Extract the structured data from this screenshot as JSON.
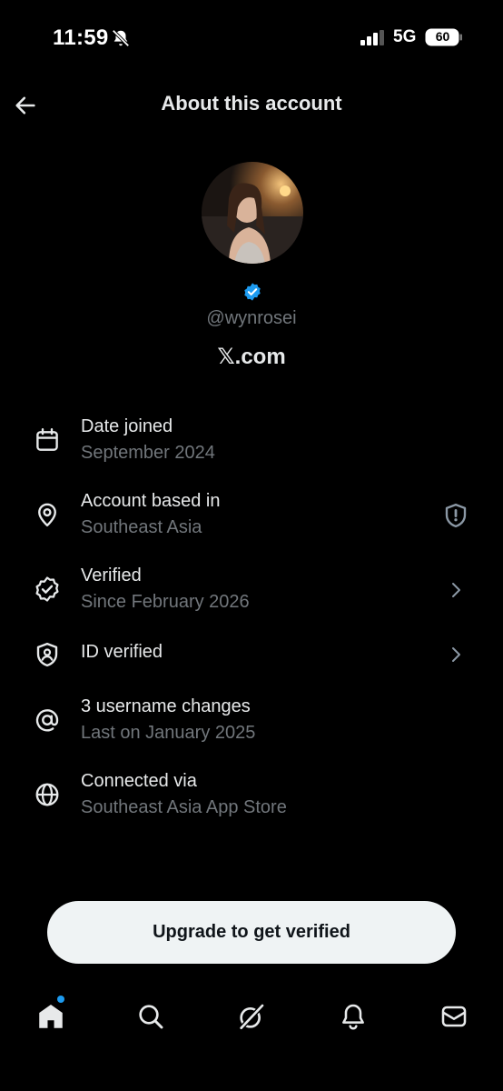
{
  "status_bar": {
    "time": "11:59",
    "network": "5G",
    "battery": "60"
  },
  "header": {
    "title": "About this account"
  },
  "profile": {
    "handle": "@wynrosei",
    "domain": "𝕏.com",
    "verified_color": "#1d9bf0"
  },
  "info": [
    {
      "icon": "calendar-icon",
      "title": "Date joined",
      "subtitle": "September 2024"
    },
    {
      "icon": "location-pin-icon",
      "title": "Account based in",
      "subtitle": "Southeast Asia",
      "trailing": "shield-alert-icon"
    },
    {
      "icon": "verified-badge-icon",
      "title": "Verified",
      "subtitle": "Since February 2026",
      "trailing": "chevron-right-icon"
    },
    {
      "icon": "id-shield-icon",
      "title": "ID verified",
      "trailing": "chevron-right-icon"
    },
    {
      "icon": "at-sign-icon",
      "title": "3 username changes",
      "subtitle": "Last on January 2025"
    },
    {
      "icon": "globe-icon",
      "title": "Connected via",
      "subtitle": "Southeast Asia App Store"
    }
  ],
  "actions": {
    "upgrade_label": "Upgrade to get verified"
  },
  "tab_bar": {
    "tabs": [
      "home",
      "search",
      "grok",
      "notifications",
      "messages"
    ],
    "accent": "#1d9bf0"
  }
}
